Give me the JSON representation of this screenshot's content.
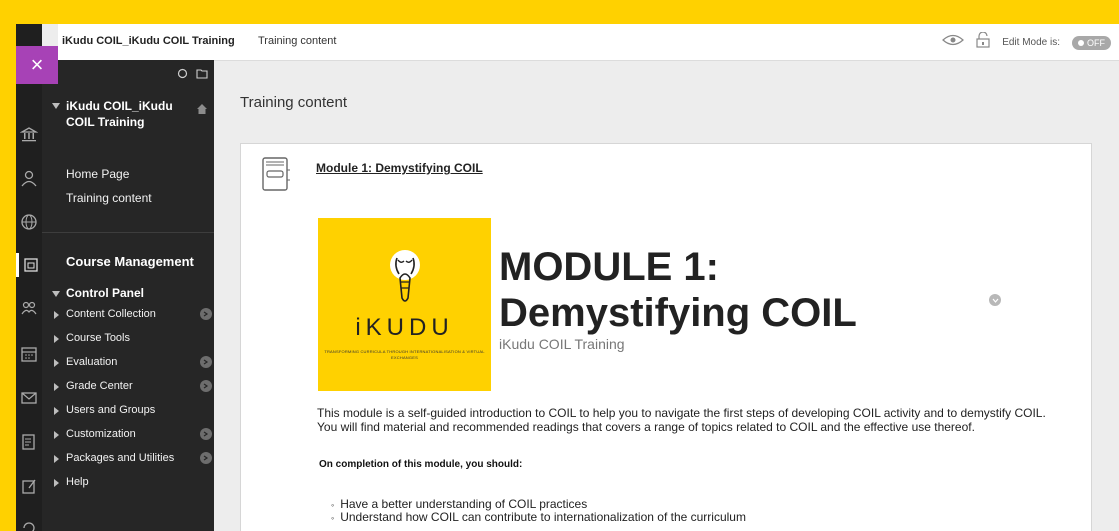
{
  "close_button": {
    "label": "×"
  },
  "rail_icons": [
    "institution-icon",
    "profile-icon",
    "globe-icon",
    "courses-icon",
    "organizations-icon",
    "calendar-icon",
    "messages-icon",
    "grades-icon",
    "tools-icon",
    "refresh-icon"
  ],
  "topbar": {
    "course_crumb": "iKudu COIL_iKudu COIL Training",
    "page_crumb": "Training content",
    "edit_mode_label": "Edit Mode is:",
    "edit_mode_value": "OFF"
  },
  "course_menu": {
    "title": "iKudu COIL_iKudu COIL Training",
    "links": [
      "Home Page",
      "Training content"
    ],
    "management_title": "Course Management",
    "control_panel": "Control Panel",
    "control_items": [
      {
        "label": "Content Collection",
        "has_menu": true
      },
      {
        "label": "Course Tools",
        "has_menu": false
      },
      {
        "label": "Evaluation",
        "has_menu": true
      },
      {
        "label": "Grade Center",
        "has_menu": true
      },
      {
        "label": "Users and Groups",
        "has_menu": false
      },
      {
        "label": "Customization",
        "has_menu": true
      },
      {
        "label": "Packages and Utilities",
        "has_menu": true
      },
      {
        "label": "Help",
        "has_menu": false
      }
    ]
  },
  "main": {
    "page_title": "Training content",
    "item": {
      "title": "Module 1: Demystifying COIL",
      "banner_word": "iKUDU",
      "banner_tagline": "TRANSFORMING CURRICULA THROUGH INTERNATIONALISATION & VIRTUAL EXCHANGES",
      "heading_line1": "MODULE 1:",
      "heading_line2": "Demystifying COIL",
      "subheading": "iKudu COIL Training",
      "paragraph": " This module is a self-guided introduction to COIL to help you to navigate the first steps of developing COIL activity and to demystify COIL. You will find material and recommended readings that covers a range of topics related to COIL and the effective use thereof.",
      "completion_label": "On completion of this module, you should:",
      "bullets": [
        "Have a better understanding of COIL practices",
        "Understand how COIL can contribute to internationalization of the curriculum"
      ]
    }
  },
  "colors": {
    "accent_yellow": "#FFD100",
    "close_purple": "#A742B6",
    "menu_dark": "#262626"
  }
}
